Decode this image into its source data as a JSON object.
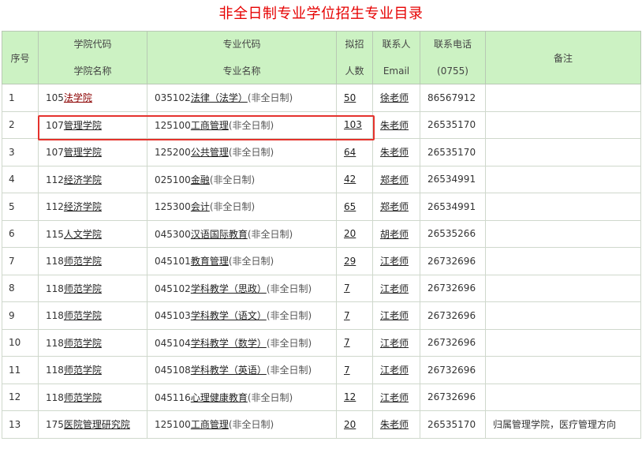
{
  "title": "非全日制专业学位招生专业目录",
  "headers": {
    "seq": "序号",
    "college_code": "学院代码",
    "college_name": "学院名称",
    "major_code": "专业代码",
    "major_name": "专业名称",
    "quota_top": "拟招",
    "quota_bottom": "人数",
    "contact_top": "联系人",
    "contact_bottom": "Email",
    "phone_top": "联系电话",
    "phone_bottom": "(0755)",
    "remark": "备注"
  },
  "rows": [
    {
      "seq": "1",
      "college_code": "105",
      "college_name": "法学院",
      "major_code": "035102",
      "major_name": "法律（法学）",
      "mode": "(非全日制)",
      "quota": "50",
      "contact": "徐老师",
      "phone": "86567912",
      "remark": ""
    },
    {
      "seq": "2",
      "college_code": "107",
      "college_name": "管理学院",
      "major_code": "125100",
      "major_name": "工商管理",
      "mode": "(非全日制)",
      "quota": "103",
      "contact": "朱老师",
      "phone": "26535170",
      "remark": ""
    },
    {
      "seq": "3",
      "college_code": "107",
      "college_name": "管理学院",
      "major_code": "125200",
      "major_name": "公共管理",
      "mode": "(非全日制)",
      "quota": "64",
      "contact": "朱老师",
      "phone": "26535170",
      "remark": ""
    },
    {
      "seq": "4",
      "college_code": "112",
      "college_name": "经济学院",
      "major_code": "025100",
      "major_name": "金融",
      "mode": "(非全日制)",
      "quota": "42",
      "contact": "郑老师",
      "phone": "26534991",
      "remark": ""
    },
    {
      "seq": "5",
      "college_code": "112",
      "college_name": "经济学院",
      "major_code": "125300",
      "major_name": "会计",
      "mode": "(非全日制)",
      "quota": "65",
      "contact": "郑老师",
      "phone": "26534991",
      "remark": ""
    },
    {
      "seq": "6",
      "college_code": "115",
      "college_name": "人文学院",
      "major_code": "045300",
      "major_name": "汉语国际教育",
      "mode": "(非全日制)",
      "quota": "20",
      "contact": "胡老师",
      "phone": "26535266",
      "remark": ""
    },
    {
      "seq": "7",
      "college_code": "118",
      "college_name": "师范学院",
      "major_code": "045101",
      "major_name": "教育管理",
      "mode": "(非全日制)",
      "quota": "29",
      "contact": "江老师",
      "phone": "26732696",
      "remark": ""
    },
    {
      "seq": "8",
      "college_code": "118",
      "college_name": "师范学院",
      "major_code": "045102",
      "major_name": "学科教学（思政）",
      "mode": "(非全日制)",
      "quota": "7",
      "contact": "江老师",
      "phone": "26732696",
      "remark": ""
    },
    {
      "seq": "9",
      "college_code": "118",
      "college_name": "师范学院",
      "major_code": "045103",
      "major_name": "学科教学（语文）",
      "mode": "(非全日制)",
      "quota": "7",
      "contact": "江老师",
      "phone": "26732696",
      "remark": ""
    },
    {
      "seq": "10",
      "college_code": "118",
      "college_name": "师范学院",
      "major_code": "045104",
      "major_name": "学科教学（数学）",
      "mode": "(非全日制)",
      "quota": "7",
      "contact": "江老师",
      "phone": "26732696",
      "remark": ""
    },
    {
      "seq": "11",
      "college_code": "118",
      "college_name": "师范学院",
      "major_code": "045108",
      "major_name": "学科教学（英语）",
      "mode": "(非全日制)",
      "quota": "7",
      "contact": "江老师",
      "phone": "26732696",
      "remark": ""
    },
    {
      "seq": "12",
      "college_code": "118",
      "college_name": "师范学院",
      "major_code": "045116",
      "major_name": "心理健康教育",
      "mode": "(非全日制)",
      "quota": "12",
      "contact": "江老师",
      "phone": "26732696",
      "remark": ""
    },
    {
      "seq": "13",
      "college_code": "175",
      "college_name": "医院管理研究院",
      "major_code": "125100",
      "major_name": "工商管理",
      "mode": "(非全日制)",
      "quota": "20",
      "contact": "朱老师",
      "phone": "26535170",
      "remark": "归属管理学院，医疗管理方向"
    }
  ],
  "colors": {
    "title": "#e60000",
    "header_bg": "#ccf2c3",
    "highlight": "#e5322d",
    "first_college_link": "#8b0000"
  }
}
